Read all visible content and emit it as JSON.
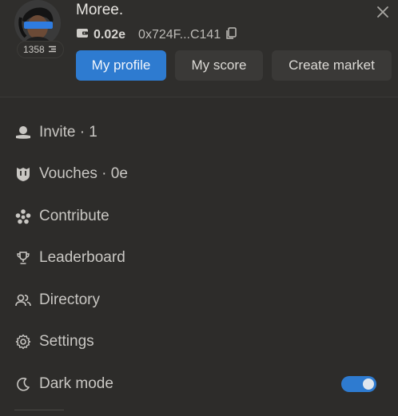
{
  "profile": {
    "name": "Moree.",
    "score": "1358",
    "balance": "0.02e",
    "address": "0x724F...C141"
  },
  "buttons": {
    "my_profile": "My profile",
    "my_score": "My score",
    "create_market": "Create market"
  },
  "menu": [
    {
      "label": "Invite · 1",
      "icon": "coin-hand-icon"
    },
    {
      "label": "Vouches · 0e",
      "icon": "vouch-shield-icon"
    },
    {
      "label": "Contribute",
      "icon": "contribute-star-icon"
    },
    {
      "label": "Leaderboard",
      "icon": "trophy-icon"
    },
    {
      "label": "Directory",
      "icon": "people-icon"
    },
    {
      "label": "Settings",
      "icon": "gear-icon"
    },
    {
      "label": "Dark mode",
      "icon": "moon-icon"
    }
  ],
  "dark_mode_enabled": true,
  "colors": {
    "accent": "#2e7bd0",
    "background": "#2d2c2a",
    "text": "#c9c7c3"
  }
}
